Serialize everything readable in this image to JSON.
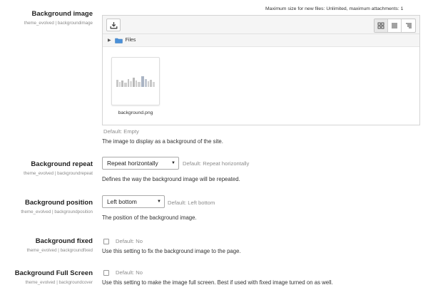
{
  "file_picker": {
    "max_size": "Maximum size for new files: Unlimited, maximum attachments: 1",
    "path_label": "Files",
    "file_name": "background.png"
  },
  "settings": {
    "bg_image": {
      "title": "Background image",
      "sub": "theme_evolved | backgroundimage",
      "default": "Default: Empty",
      "desc": "The image to display as a background of the site."
    },
    "bg_repeat": {
      "title": "Background repeat",
      "sub": "theme_evolved | backgroundrepeat",
      "value": "Repeat horizontally",
      "default": "Default: Repeat horizontally",
      "desc": "Defines the way the background image will be repeated."
    },
    "bg_position": {
      "title": "Background position",
      "sub": "theme_evolved | backgroundposition",
      "value": "Left bottom",
      "default": "Default: Left bottom",
      "desc": "The position of the background image."
    },
    "bg_fixed": {
      "title": "Background fixed",
      "sub": "theme_evolved | backgroundfixed",
      "default": "Default: No",
      "desc": "Use this setting to fix the background image to the page."
    },
    "bg_cover": {
      "title": "Background Full Screen",
      "sub": "theme_evolved | backgroundcover",
      "default": "Default: No",
      "desc": "Use this setting to make the image full screen. Best if used with fixed image turned on as well."
    }
  },
  "icons": {
    "add": "download-tray-icon",
    "view_icons": "grid-icon",
    "view_list": "list-icon",
    "view_tree": "tree-icon",
    "folder": "folder-icon",
    "expand": "triangle-right-icon",
    "select_caret": "triangle-down-icon"
  },
  "colors": {
    "folder": "#4a90d9",
    "muted": "#8c8c8c"
  }
}
